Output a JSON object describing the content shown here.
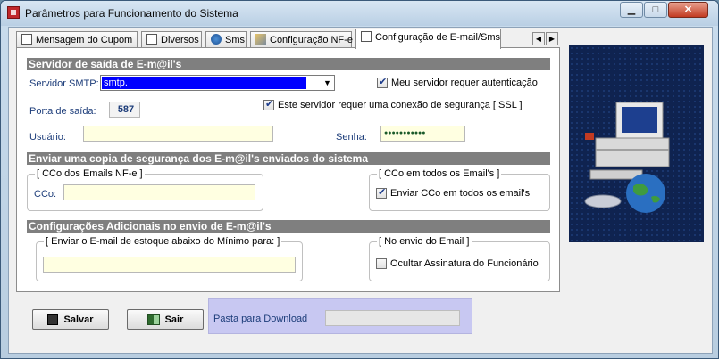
{
  "window": {
    "title": "Parâmetros para Funcionamento do Sistema"
  },
  "tabs": [
    {
      "label": "Mensagem do Cupom"
    },
    {
      "label": "Diversos"
    },
    {
      "label": "Sms"
    },
    {
      "label": "Configuração NF-e"
    },
    {
      "label": "Configuração de E-mail/Sms"
    }
  ],
  "server_section": {
    "header": "Servidor de saída de E-m@il's",
    "smtp_label": "Servidor SMTP:",
    "smtp_value": "smtp.",
    "auth_checkbox_label": "Meu servidor requer autenticação",
    "auth_checked": true,
    "ssl_checkbox_label": "Este servidor requer uma conexão de segurança [ SSL ]",
    "ssl_checked": true,
    "port_label": "Porta de saída:",
    "port_value": "587",
    "user_label": "Usuário:",
    "user_value": "",
    "password_label": "Senha:",
    "password_value": "●●●●●●●●●●●"
  },
  "backup_section": {
    "header": "Enviar uma copia de segurança dos E-m@il's enviados do sistema",
    "cco_nfe_group": "[ CCo dos Emails NF-e ]",
    "cco_label": "CCo:",
    "cco_value": "",
    "cco_all_group": "[ CCo em todos os Email's ]",
    "cco_all_checkbox_label": "Enviar CCo em todos os email's",
    "cco_all_checked": true
  },
  "additional_section": {
    "header": "Configurações Adicionais no envio de E-m@il's",
    "stock_group": "[ Enviar o E-mail de estoque abaixo do Mínimo para: ]",
    "stock_value": "",
    "sending_group": "[ No envio do Email ]",
    "hide_signature_label": "Ocultar Assinatura do Funcionário",
    "hide_signature_checked": false
  },
  "buttons": {
    "save": "Salvar",
    "exit": "Sair"
  },
  "download": {
    "label": "Pasta para Download",
    "value": ""
  },
  "colors": {
    "section_header": "#7f7f7f",
    "field_bg": "#ffffe1",
    "download_bg": "#c8c8f2"
  }
}
